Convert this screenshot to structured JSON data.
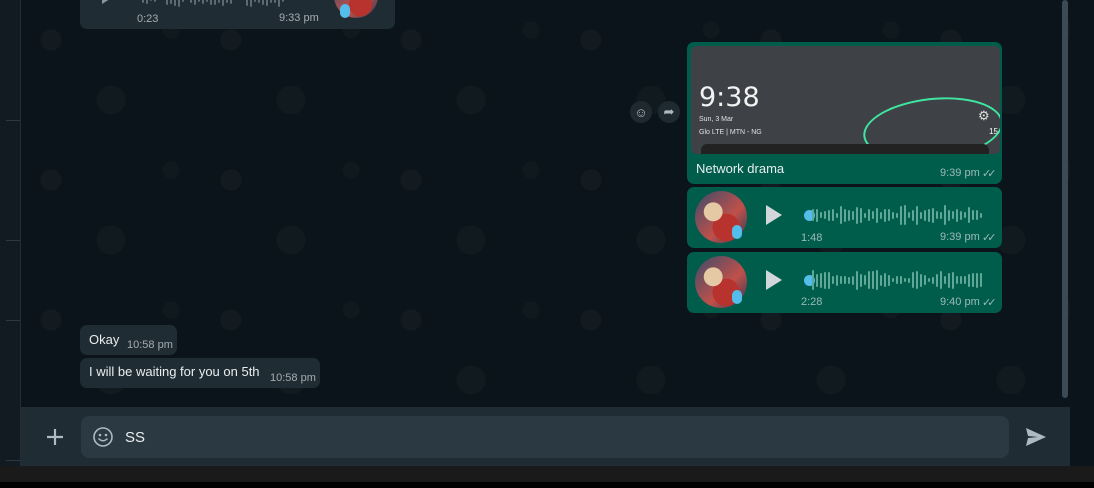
{
  "chat": {
    "top_voice": {
      "duration": "0:23",
      "time": "9:33 pm"
    },
    "image_message": {
      "caption": "Network drama",
      "time": "9:39 pm",
      "ticks": "✓✓",
      "preview": {
        "clock": "9:38",
        "date": "Sun, 3 Mar",
        "carrier": "Glo LTE | MTN - NG",
        "battery": "15"
      }
    },
    "voice_messages": [
      {
        "duration": "1:48",
        "time": "9:39 pm",
        "ticks": "✓✓"
      },
      {
        "duration": "2:28",
        "time": "9:40 pm",
        "ticks": "✓✓"
      }
    ],
    "incoming": [
      {
        "text": "Okay",
        "time": "10:58 pm"
      },
      {
        "text": "I will be waiting for you on 5th",
        "time": "10:58 pm"
      }
    ]
  },
  "composer": {
    "value": "SS",
    "add_icon": "plus-icon",
    "emoji_icon": "emoji-icon",
    "send_icon": "send-icon"
  },
  "colors": {
    "background": "#0b141a",
    "incoming_bubble": "#202c33",
    "outgoing_bubble": "#005c4b",
    "accent": "#53bdeb"
  }
}
